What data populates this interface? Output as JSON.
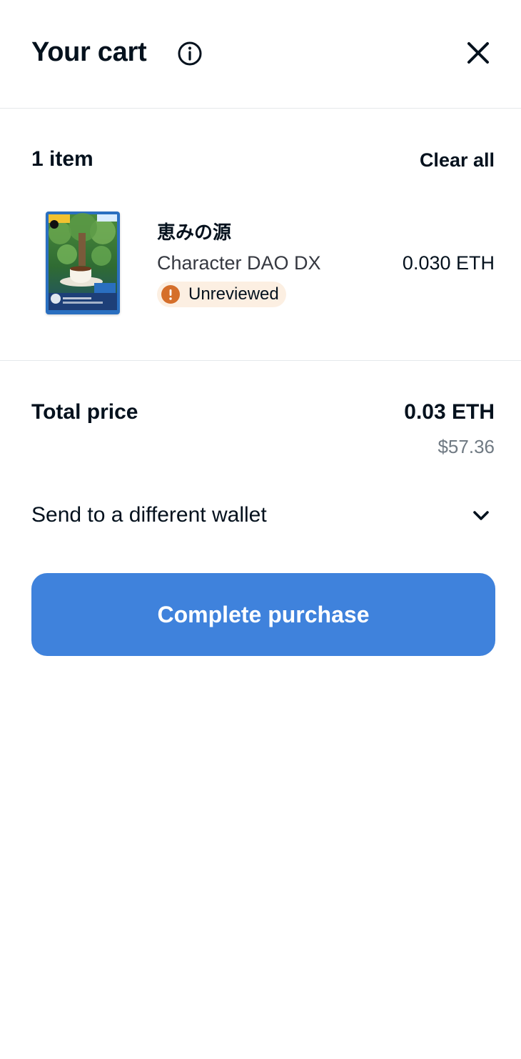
{
  "header": {
    "title": "Your cart"
  },
  "summary": {
    "item_count": "1 item",
    "clear_all_label": "Clear all"
  },
  "items": [
    {
      "name": "恵みの源",
      "collection": "Character DAO DX",
      "badge": "Unreviewed",
      "price": "0.030 ETH"
    }
  ],
  "totals": {
    "label": "Total price",
    "eth": "0.03 ETH",
    "usd": "$57.36"
  },
  "wallet": {
    "label": "Send to a different wallet"
  },
  "cta": {
    "label": "Complete purchase"
  },
  "colors": {
    "accent": "#3f82dc",
    "warning": "#d56f2b",
    "warning_bg": "#fcefe2",
    "divider": "#e5e8eb",
    "muted_text": "#707a83"
  },
  "icons": {
    "info": "info-icon",
    "close": "close-icon",
    "warning": "exclamation-icon",
    "expand": "chevron-down-icon"
  }
}
